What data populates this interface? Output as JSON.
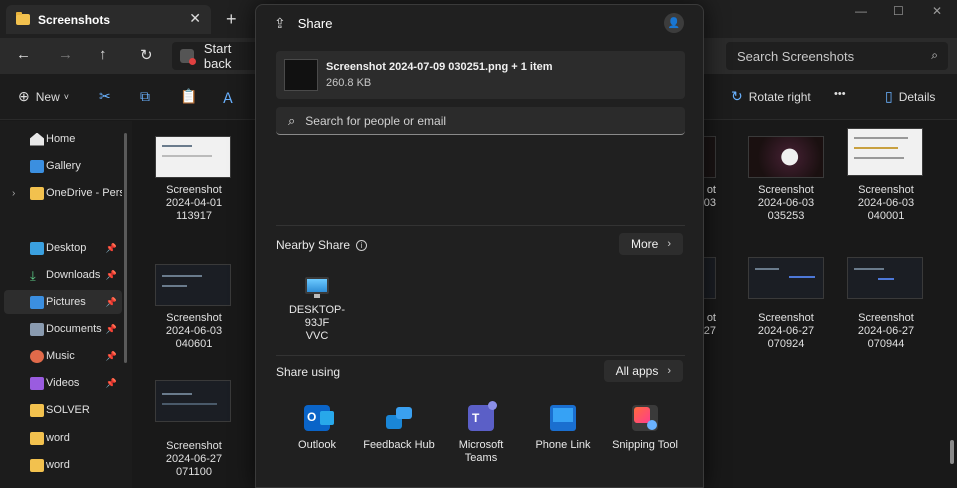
{
  "explorer": {
    "tab_title": "Screenshots",
    "address_text": "Start back",
    "search_placeholder": "Search Screenshots",
    "toolbar": {
      "new_label": "New",
      "rotate_label": "Rotate right",
      "more_label": "•••",
      "details_label": "Details"
    },
    "sidebar": [
      {
        "label": "Home",
        "icon": "home-icon",
        "pinned": false
      },
      {
        "label": "Gallery",
        "icon": "gallery-icon",
        "pinned": false
      },
      {
        "label": "OneDrive - Perso",
        "icon": "folder-icon",
        "pinned": false
      },
      {
        "label": "Desktop",
        "icon": "desktop-icon",
        "pinned": true
      },
      {
        "label": "Downloads",
        "icon": "downloads-icon",
        "pinned": true
      },
      {
        "label": "Pictures",
        "icon": "pictures-icon",
        "pinned": true
      },
      {
        "label": "Documents",
        "icon": "documents-icon",
        "pinned": true
      },
      {
        "label": "Music",
        "icon": "music-icon",
        "pinned": true
      },
      {
        "label": "Videos",
        "icon": "videos-icon",
        "pinned": true
      },
      {
        "label": "SOLVER",
        "icon": "folder-icon",
        "pinned": false
      },
      {
        "label": "word",
        "icon": "folder-icon",
        "pinned": false
      },
      {
        "label": "word",
        "icon": "folder-icon",
        "pinned": false
      }
    ],
    "files": [
      {
        "name_line1": "Screenshot",
        "name_line2": "2024-04-01",
        "name_line3": "113917"
      },
      {
        "name_line1": "Screenshot",
        "name_line2": "2024-06-03",
        "name_line3": "040601"
      },
      {
        "name_line1": "Screenshot",
        "name_line2": "2024-06-27",
        "name_line3": "071100"
      },
      {
        "name_line1": "ot",
        "name_line2": "03",
        "name_line3": ""
      },
      {
        "name_line1": "Screenshot",
        "name_line2": "2024-06-03",
        "name_line3": "035253"
      },
      {
        "name_line1": "Screenshot",
        "name_line2": "2024-06-03",
        "name_line3": "040001"
      },
      {
        "name_line1": "ot",
        "name_line2": "27",
        "name_line3": ""
      },
      {
        "name_line1": "Screenshot",
        "name_line2": "2024-06-27",
        "name_line3": "070924"
      },
      {
        "name_line1": "Screenshot",
        "name_line2": "2024-06-27",
        "name_line3": "070944"
      }
    ]
  },
  "share": {
    "title": "Share",
    "file_name": "Screenshot 2024-07-09 030251.png + 1 item",
    "file_size": "260.8 KB",
    "search_placeholder": "Search for people or email",
    "nearby_title": "Nearby Share",
    "more_label": "More",
    "device_name_line1": "DESKTOP-93JF",
    "device_name_line2": "VVC",
    "share_using_title": "Share using",
    "all_apps_label": "All apps",
    "apps": [
      {
        "name_line1": "Outlook",
        "name_line2": "",
        "icon": "outlook-icon"
      },
      {
        "name_line1": "Feedback Hub",
        "name_line2": "",
        "icon": "feedback-hub-icon"
      },
      {
        "name_line1": "Microsoft",
        "name_line2": "Teams",
        "icon": "teams-icon"
      },
      {
        "name_line1": "Phone Link",
        "name_line2": "",
        "icon": "phone-link-icon"
      },
      {
        "name_line1": "Snipping Tool",
        "name_line2": "",
        "icon": "snipping-tool-icon"
      }
    ]
  },
  "colors": {
    "window_bg": "#191919",
    "dialog_bg": "#202020",
    "accent": "#6ab2ff"
  }
}
